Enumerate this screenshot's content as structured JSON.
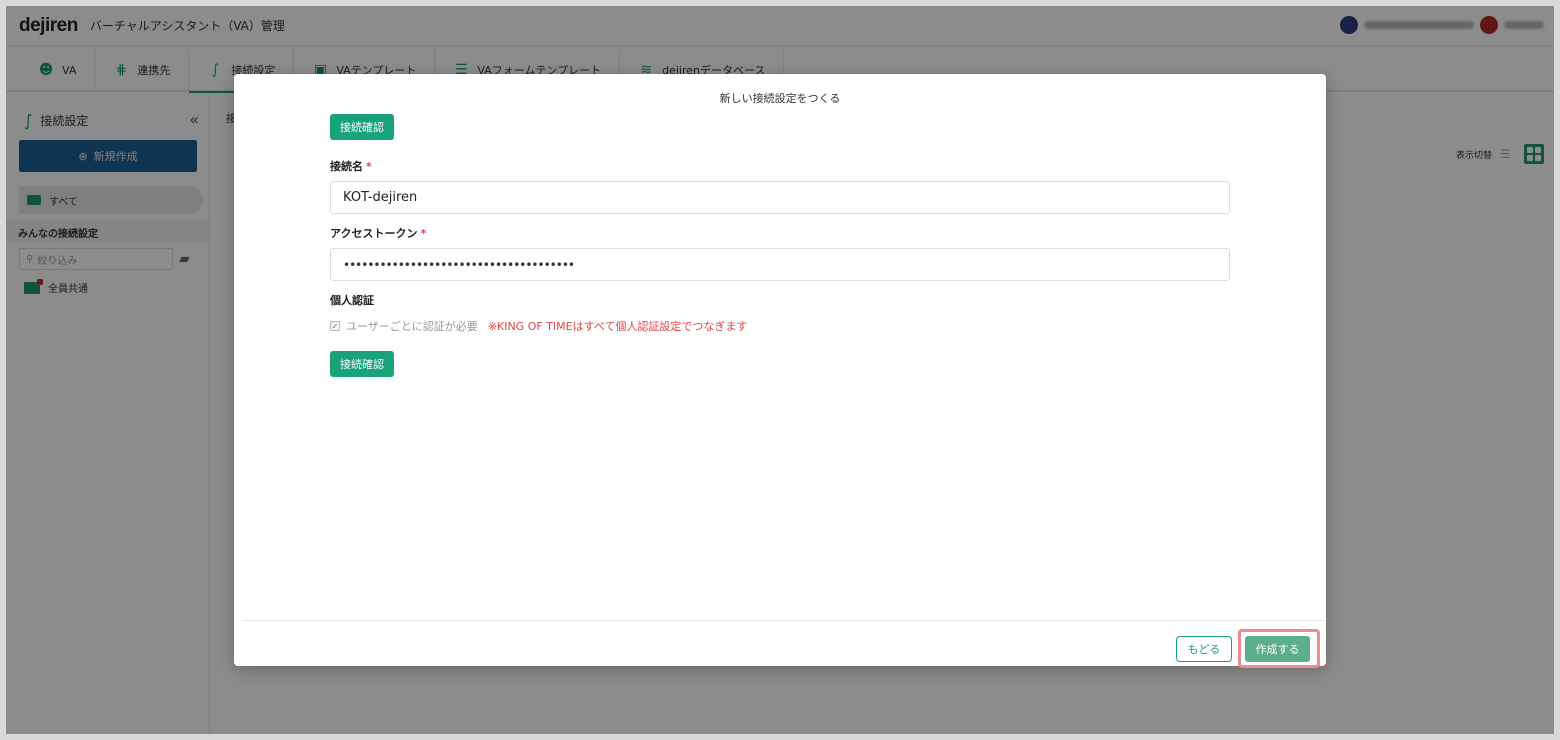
{
  "header": {
    "logo": "dejiren",
    "title": "バーチャルアシスタント（VA）管理"
  },
  "tabs": [
    {
      "label": "VA",
      "icon": "robot-icon"
    },
    {
      "label": "連携先",
      "icon": "integrations-icon"
    },
    {
      "label": "接続設定",
      "icon": "connection-icon",
      "active": true
    },
    {
      "label": "VAテンプレート",
      "icon": "template-icon"
    },
    {
      "label": "VAフォームテンプレート",
      "icon": "form-template-icon"
    },
    {
      "label": "dejirenデータベース",
      "icon": "database-icon"
    }
  ],
  "sidebar": {
    "title": "接続設定",
    "new_button": "新規作成",
    "all_label": "すべて",
    "section_title": "みんなの接続設定",
    "filter_placeholder": "絞り込み",
    "items": [
      {
        "label": "全員共通"
      }
    ]
  },
  "content": {
    "stub_label": "接",
    "view_toggle_label": "表示切替"
  },
  "modal": {
    "title": "新しい接続設定をつくる",
    "check_button_top": "接続確認",
    "name_label": "接続名",
    "name_value": "KOT-dejiren",
    "token_label": "アクセストークン",
    "token_value": "••••••••••••••••••••••••••••••••••••••",
    "auth_label": "個人認証",
    "auth_checkbox_label": "ユーザーごとに認証が必要",
    "auth_checked": true,
    "auth_note": "※KING OF TIMEはすべて個人認証設定でつなぎます",
    "check_button_bottom": "接続確認",
    "back_button": "もどる",
    "create_button": "作成する"
  },
  "colors": {
    "accent": "#1aa37a",
    "primary_blue": "#1b5f96",
    "required": "#e04545",
    "highlight": "#f08a95"
  }
}
